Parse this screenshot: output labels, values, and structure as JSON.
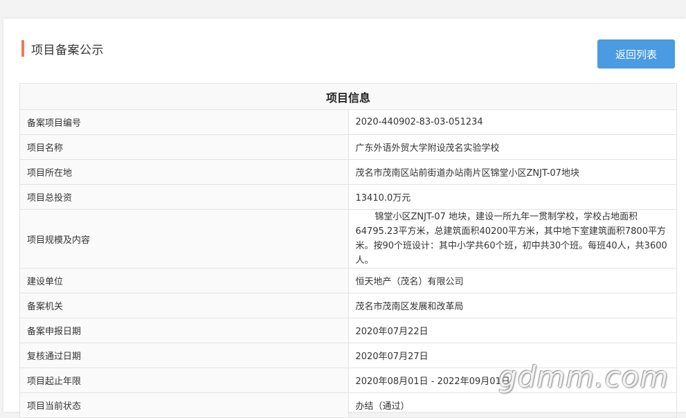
{
  "header": {
    "title": "项目备案公示",
    "back_label": "返回列表"
  },
  "table": {
    "title": "项目信息",
    "rows": [
      {
        "label": "备案项目编号",
        "value": "2020-440902-83-03-051234"
      },
      {
        "label": "项目名称",
        "value": "广东外语外贸大学附设茂名实验学校"
      },
      {
        "label": "项目所在地",
        "value": "茂名市茂南区站前街道办站南片区锦堂小区ZNJT-07地块"
      },
      {
        "label": "项目总投资",
        "value": "13410.0万元"
      },
      {
        "label": "项目规模及内容",
        "value": "锦堂小区ZNJT-07 地块，建设一所九年一贯制学校，学校占地面积64795.23平方米，总建筑面积40200平方米，其中地下室建筑面积7800平方米。按90个班设计：其中小学共60个班，初中共30个班。每班40人，共3600人。"
      },
      {
        "label": "建设单位",
        "value": "恒天地产（茂名）有限公司"
      },
      {
        "label": "备案机关",
        "value": "茂名市茂南区发展和改革局"
      },
      {
        "label": "备案申报日期",
        "value": "2020年07月22日"
      },
      {
        "label": "复核通过日期",
        "value": "2020年07月27日"
      },
      {
        "label": "项目起止年限",
        "value": "2020年08月01日 - 2022年09月01日"
      },
      {
        "label": "项目当前状态",
        "value": "办结（通过）"
      }
    ]
  },
  "watermark": "gdmm.com",
  "colors": {
    "accent": "#f07a55",
    "button": "#4a9be2"
  }
}
